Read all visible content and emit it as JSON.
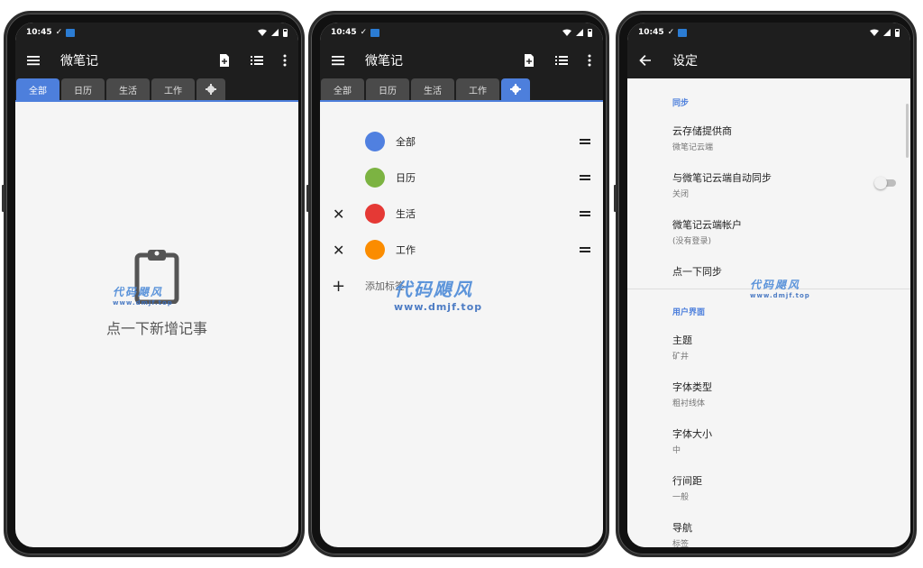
{
  "phone1": {
    "status": {
      "time": "10:45",
      "check": "✓"
    },
    "app_title": "微笔记",
    "tabs": [
      {
        "label": "全部",
        "active": true
      },
      {
        "label": "日历",
        "active": false
      },
      {
        "label": "生活",
        "active": false
      },
      {
        "label": "工作",
        "active": false
      }
    ],
    "empty_message": "点一下新增记事"
  },
  "phone2": {
    "status": {
      "time": "10:45",
      "check": "✓"
    },
    "app_title": "微笔记",
    "tabs": [
      {
        "label": "全部",
        "active": false
      },
      {
        "label": "日历",
        "active": false
      },
      {
        "label": "生活",
        "active": false
      },
      {
        "label": "工作",
        "active": false
      }
    ],
    "labels": [
      {
        "name": "全部",
        "color": "#5080e0",
        "deletable": false
      },
      {
        "name": "日历",
        "color": "#7cb342",
        "deletable": false
      },
      {
        "name": "生活",
        "color": "#e53935",
        "deletable": true
      },
      {
        "name": "工作",
        "color": "#fb8c00",
        "deletable": true
      }
    ],
    "delete_symbol": "✕",
    "add_symbol": "+",
    "add_label": "添加标签"
  },
  "phone3": {
    "status": {
      "time": "10:45",
      "check": "✓"
    },
    "title": "设定",
    "sections": [
      {
        "header": "同步",
        "items": [
          {
            "title": "云存储提供商",
            "subtitle": "微笔记云端"
          },
          {
            "title": "与微笔记云端自动同步",
            "subtitle": "关闭",
            "toggle": false
          },
          {
            "title": "微笔记云端帐户",
            "subtitle": "(没有登录)"
          },
          {
            "title": "点一下同步",
            "subtitle": ""
          }
        ]
      },
      {
        "header": "用户界面",
        "items": [
          {
            "title": "主题",
            "subtitle": "矿井"
          },
          {
            "title": "字体类型",
            "subtitle": "粗衬线体"
          },
          {
            "title": "字体大小",
            "subtitle": "中"
          },
          {
            "title": "行间距",
            "subtitle": "一般"
          },
          {
            "title": "导航",
            "subtitle": "标签"
          }
        ]
      }
    ]
  },
  "watermark": {
    "brand": "代码飓风",
    "url": "www.dmjf.top"
  },
  "colors": {
    "accent": "#4d7fdc",
    "appbar": "#1e1e1e",
    "background": "#f5f5f5"
  },
  "icons": [
    "menu-icon",
    "new-note-icon",
    "list-view-icon",
    "more-vert-icon",
    "gear-icon",
    "back-arrow-icon",
    "clipboard-icon",
    "wifi-icon",
    "signal-icon",
    "battery-icon"
  ]
}
